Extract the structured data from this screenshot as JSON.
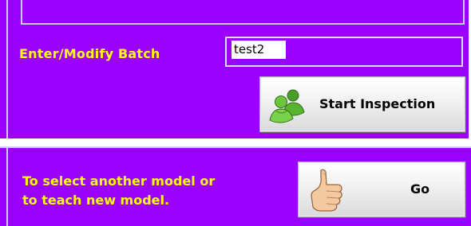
{
  "batch": {
    "label": "Enter/Modify Batch",
    "value": "test2"
  },
  "actions": {
    "start_inspection_label": "Start Inspection",
    "go_label": "Go"
  },
  "model_selection": {
    "instruction_line1": "To select another model or",
    "instruction_line2": "to teach new model."
  },
  "icons": {
    "start_inspection": "users-icon",
    "go": "thumbs-up-icon"
  },
  "colors": {
    "panel_background": "#9b00ff",
    "label_text": "#ffff00",
    "button_text": "#000000"
  }
}
